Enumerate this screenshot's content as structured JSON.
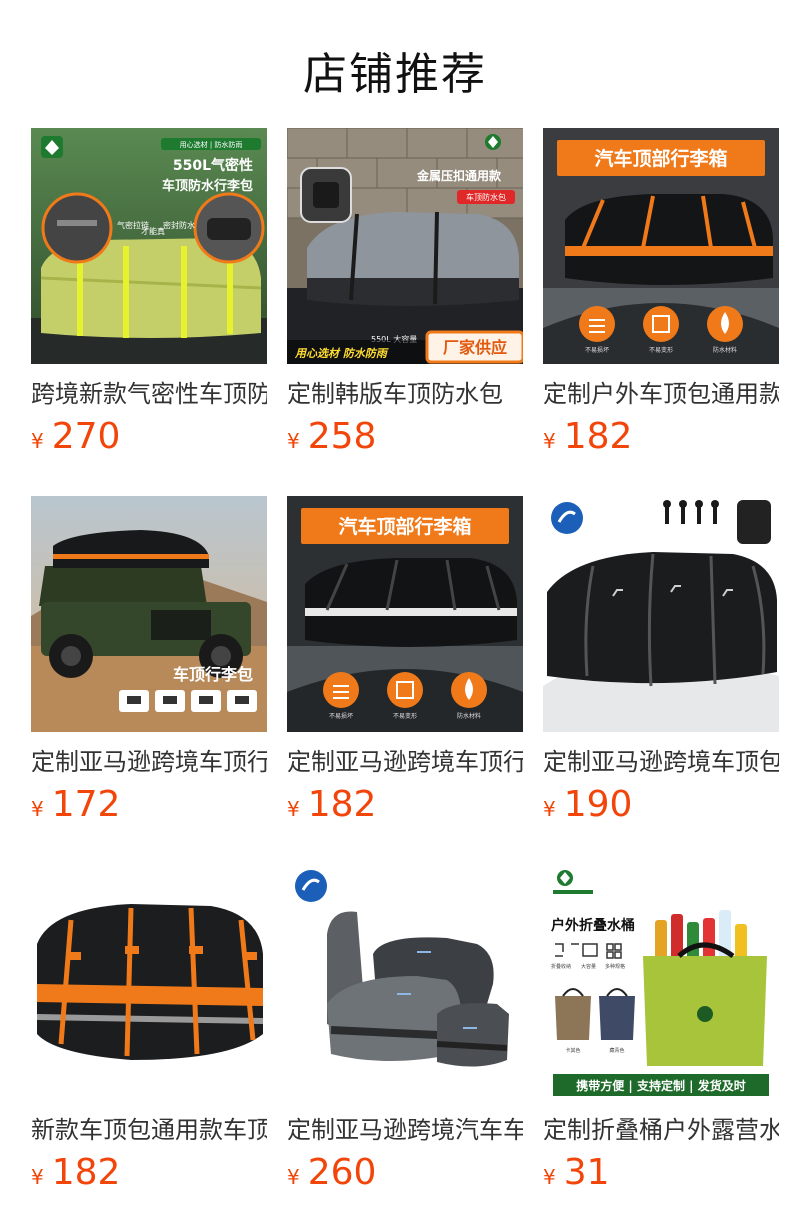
{
  "page": {
    "title": "店铺推荐"
  },
  "products": [
    {
      "title": "跨境新款气密性车顶防水行李包",
      "currency": "¥",
      "price": "270",
      "image_text": {
        "badge": "用心选材 | 防水防雨",
        "headline1": "550L气密性",
        "headline2": "车顶防水行李包",
        "label1": "气密拉链",
        "label2": "才能真",
        "label3": "密封防水"
      }
    },
    {
      "title": "定制韩版车顶防水包",
      "currency": "¥",
      "price": "258",
      "image_text": {
        "headline": "金属压扣通用款",
        "tag": "车顶防水包",
        "capacity": "550L 大容量",
        "banner_left": "用心选材 防水防雨",
        "banner_right": "厂家供应"
      }
    },
    {
      "title": "定制户外车顶包通用款车顶行李箱",
      "currency": "¥",
      "price": "182",
      "image_text": {
        "banner": "汽车顶部行李箱",
        "f1": "不易损坏",
        "f2": "不易变形",
        "f3": "防水材料"
      }
    },
    {
      "title": "定制亚马逊跨境车顶行李包",
      "currency": "¥",
      "price": "172",
      "image_text": {
        "caption": "车顶行李包"
      }
    },
    {
      "title": "定制亚马逊跨境车顶行李箱",
      "currency": "¥",
      "price": "182",
      "image_text": {
        "banner": "汽车顶部行李箱",
        "f1": "不易损坏",
        "f2": "不易变形",
        "f3": "防水材料"
      }
    },
    {
      "title": "定制亚马逊跨境车顶包",
      "currency": "¥",
      "price": "190",
      "image_text": {}
    },
    {
      "title": "新款车顶包通用款车顶行李包",
      "currency": "¥",
      "price": "182",
      "image_text": {}
    },
    {
      "title": "定制亚马逊跨境汽车车顶包",
      "currency": "¥",
      "price": "260",
      "image_text": {}
    },
    {
      "title": "定制折叠桶户外露营水桶",
      "currency": "¥",
      "price": "31",
      "image_text": {
        "headline": "户外折叠水桶",
        "f1": "折叠收纳",
        "f2": "大容量",
        "f3": "多种规格",
        "c1": "卡其色",
        "c2": "藏青色",
        "banner": "携带方便 | 支持定制 | 发货及时"
      }
    }
  ],
  "icons": {
    "brand-logo": "leaf-shield-icon",
    "store-badge": "store-badge-icon"
  },
  "colors": {
    "price": "#f2450a",
    "accent_orange": "#f07a1a",
    "brand_green": "#1e7a2f"
  }
}
